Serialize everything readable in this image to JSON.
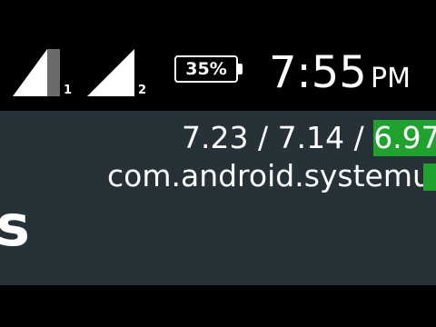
{
  "status_bar": {
    "sim1_label": "1",
    "sim2_label": "2",
    "battery_text": "35%",
    "time": "7:55",
    "ampm": "PM"
  },
  "load_overlay": {
    "load_1": "7.23",
    "separator": " / ",
    "load_5": "7.14",
    "load_15": "6.97",
    "process": "com.android.systemui"
  },
  "app_content": {
    "partial_title": "s"
  },
  "colors": {
    "status_bar_bg": "#000000",
    "content_bg": "#263238",
    "cpu_user_green": "#1fa32e",
    "cpu_system_red": "#b71c1c"
  },
  "icons": [
    "signal-strength-icon",
    "battery-icon"
  ]
}
